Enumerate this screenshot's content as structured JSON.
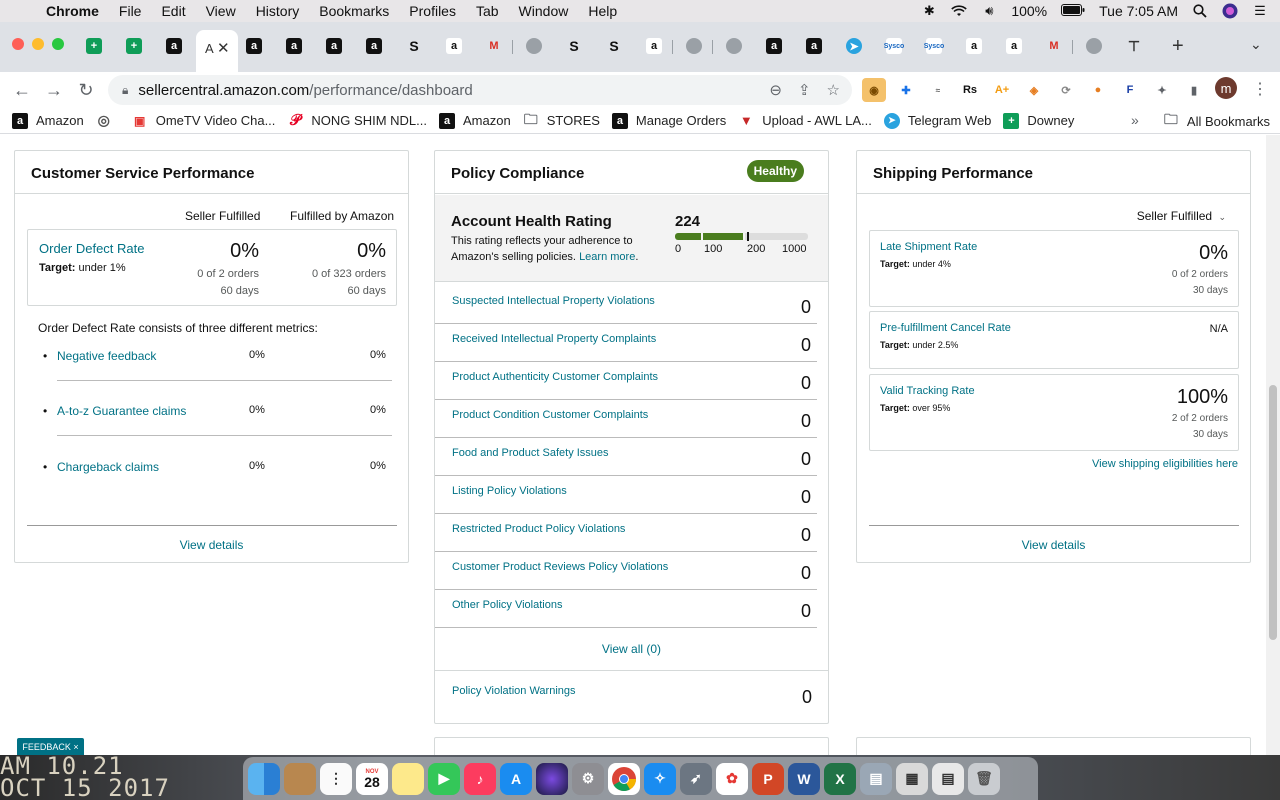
{
  "menubar": {
    "app": "Chrome",
    "menus": [
      "File",
      "Edit",
      "View",
      "History",
      "Bookmarks",
      "Profiles",
      "Tab",
      "Window",
      "Help"
    ],
    "battery": "100%",
    "clock": "Tue 7:05 AM"
  },
  "browser": {
    "active_tab_label": "A",
    "url_domain": "sellercentral.amazon.com",
    "url_path": "/performance/dashboard",
    "profile_initial": "m"
  },
  "bookmarks": [
    {
      "label": "Amazon",
      "icon": "amazon-icon"
    },
    {
      "label": "",
      "icon": "globe-icon"
    },
    {
      "label": "OmeTV Video Cha...",
      "icon": "ometv-icon"
    },
    {
      "label": "NONG SHIM NDL...",
      "icon": "pinterest-icon"
    },
    {
      "label": "Amazon",
      "icon": "amazon-icon"
    },
    {
      "label": "STORES",
      "icon": "folder-icon"
    },
    {
      "label": "Manage Orders",
      "icon": "amazon-icon"
    },
    {
      "label": "Upload - AWL LA...",
      "icon": "awl-icon"
    },
    {
      "label": "Telegram Web",
      "icon": "telegram-icon"
    },
    {
      "label": "Downey",
      "icon": "sheets-icon"
    }
  ],
  "bookmarks_all": "All Bookmarks",
  "customer_service": {
    "title": "Customer Service Performance",
    "col1": "Seller Fulfilled",
    "col2": "Fulfilled by Amazon",
    "odr_label": "Order Defect Rate",
    "odr_target_label": "Target:",
    "odr_target": "under 1%",
    "sf_value": "0%",
    "sf_orders": "0 of 2 orders",
    "sf_days": "60 days",
    "fba_value": "0%",
    "fba_orders": "0 of 323 orders",
    "fba_days": "60 days",
    "metrics_intro": "Order Defect Rate consists of three different metrics:",
    "metrics": [
      {
        "label": "Negative feedback",
        "sf": "0%",
        "fba": "0%"
      },
      {
        "label": "A-to-z Guarantee claims",
        "sf": "0%",
        "fba": "0%"
      },
      {
        "label": "Chargeback claims",
        "sf": "0%",
        "fba": "0%"
      }
    ],
    "view_details": "View details"
  },
  "policy": {
    "title": "Policy Compliance",
    "badge": "Healthy",
    "ahr_title": "Account Health Rating",
    "ahr_desc_1": "This rating reflects your adherence to",
    "ahr_desc_2": "Amazon's selling policies.",
    "learn_more": "Learn more",
    "rating": "224",
    "rating_value": 224,
    "scale": [
      "0",
      "100",
      "200",
      "1000"
    ],
    "rows": [
      {
        "label": "Suspected Intellectual Property Violations",
        "value": "0"
      },
      {
        "label": "Received Intellectual Property Complaints",
        "value": "0"
      },
      {
        "label": "Product Authenticity Customer Complaints",
        "value": "0"
      },
      {
        "label": "Product Condition Customer Complaints",
        "value": "0"
      },
      {
        "label": "Food and Product Safety Issues",
        "value": "0"
      },
      {
        "label": "Listing Policy Violations",
        "value": "0"
      },
      {
        "label": "Restricted Product Policy Violations",
        "value": "0"
      },
      {
        "label": "Customer Product Reviews Policy Violations",
        "value": "0"
      },
      {
        "label": "Other Policy Violations",
        "value": "0"
      }
    ],
    "view_all": "View all (0)",
    "warnings_label": "Policy Violation Warnings",
    "warnings_value": "0"
  },
  "shipping": {
    "title": "Shipping Performance",
    "filter": "Seller Fulfilled",
    "metrics": [
      {
        "label": "Late Shipment Rate",
        "target": "under 4%",
        "value": "0%",
        "orders": "0 of 2 orders",
        "days": "30 days"
      },
      {
        "label": "Pre-fulfillment Cancel Rate",
        "target": "under 2.5%",
        "value": "N/A",
        "orders": "",
        "days": ""
      },
      {
        "label": "Valid Tracking Rate",
        "target": "over 95%",
        "value": "100%",
        "orders": "2 of 2 orders",
        "days": "30 days"
      }
    ],
    "target_label": "Target:",
    "eligibility_link": "View shipping eligibilities here",
    "view_details": "View details"
  },
  "feedback": "FEEDBACK ×",
  "desktop_text": {
    "line1": "AM 10.21",
    "line2": "OCT 15 2017"
  },
  "dock_calendar": {
    "month": "NOV",
    "day": "28"
  },
  "colors": {
    "accent_link": "#007185",
    "healthy": "#4a7d1e",
    "rating_bar": "#4a7d1e"
  }
}
